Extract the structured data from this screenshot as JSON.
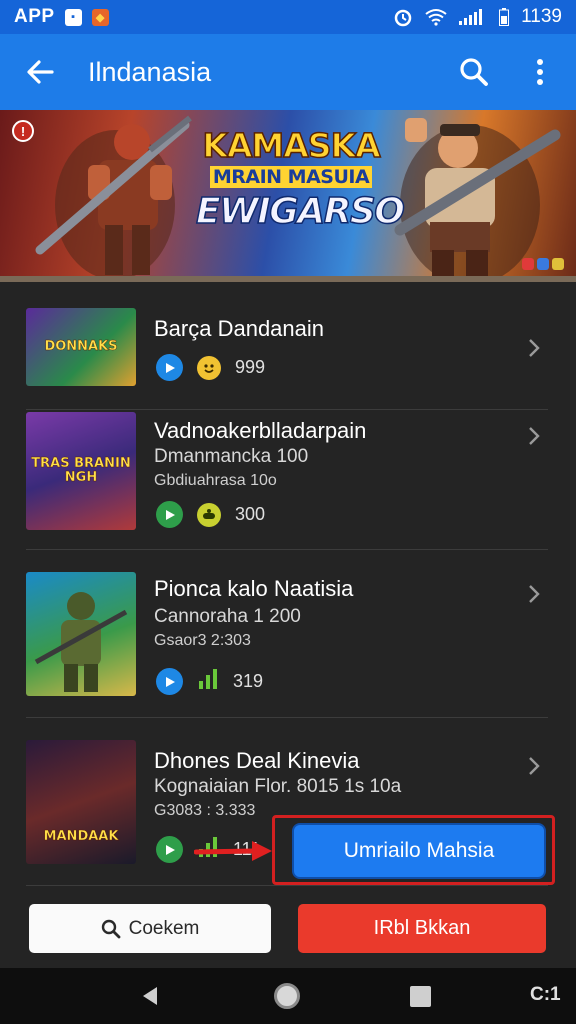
{
  "status_bar": {
    "app_label": "APP",
    "time": "1139",
    "icons": [
      "notification-icon",
      "shop-icon",
      "alarm-icon",
      "wifi-icon",
      "signal-icon",
      "battery-icon"
    ]
  },
  "app_bar": {
    "title": "Ilndanasia",
    "icons": [
      "back-arrow-icon",
      "search-icon",
      "more-vert-icon"
    ]
  },
  "banner": {
    "badge": "!",
    "line1": "KAMASKA",
    "line2": "MRAIN MASUIA",
    "line3": "EWIGARSO"
  },
  "games": [
    {
      "thumb_text": "DONNAKS",
      "title": "Barça Dandanain",
      "subtitle": "",
      "detail": "",
      "meta": "999",
      "play_color": "#1e88e5",
      "rate_icon": "emoji-icon"
    },
    {
      "thumb_text": "TRAS BRANIN NGH",
      "title": "Vadnoakerblladarpain",
      "subtitle": "Dmanmancka 100",
      "detail": "Gbdiuahrasa 10o",
      "meta": "300",
      "play_color": "#2e9e4a",
      "rate_icon": "joystick-icon"
    },
    {
      "thumb_text": "",
      "title": "Pionca kalo Naatisia",
      "subtitle": "Cannoraha 1 200",
      "detail": "Gsaor3 2:303",
      "meta": "319",
      "play_color": "#1e88e5",
      "rate_icon": "signal-bars-icon"
    },
    {
      "thumb_text": "MANDAAK",
      "title": "Dhones Deal Kinevia",
      "subtitle": "Kognaiaian Flor. 8015 1s 10a",
      "detail": "G3083 : 3.333",
      "meta": "111",
      "play_color": "#2e9e4a",
      "rate_icon": "signal-bars-icon"
    }
  ],
  "download_button": {
    "label": "Umriailo Mahsia"
  },
  "actions": {
    "secondary_label": "Coekem",
    "primary_label": "IRbl Bkkan"
  },
  "nav_bar": {
    "extra": "C:1"
  },
  "colors": {
    "status_blue": "#1565d8",
    "appbar_blue": "#1e7ce8",
    "background": "#242424",
    "download_blue": "#1d7bf0",
    "highlight_red": "#d32020",
    "primary_red": "#ea3a2c"
  }
}
